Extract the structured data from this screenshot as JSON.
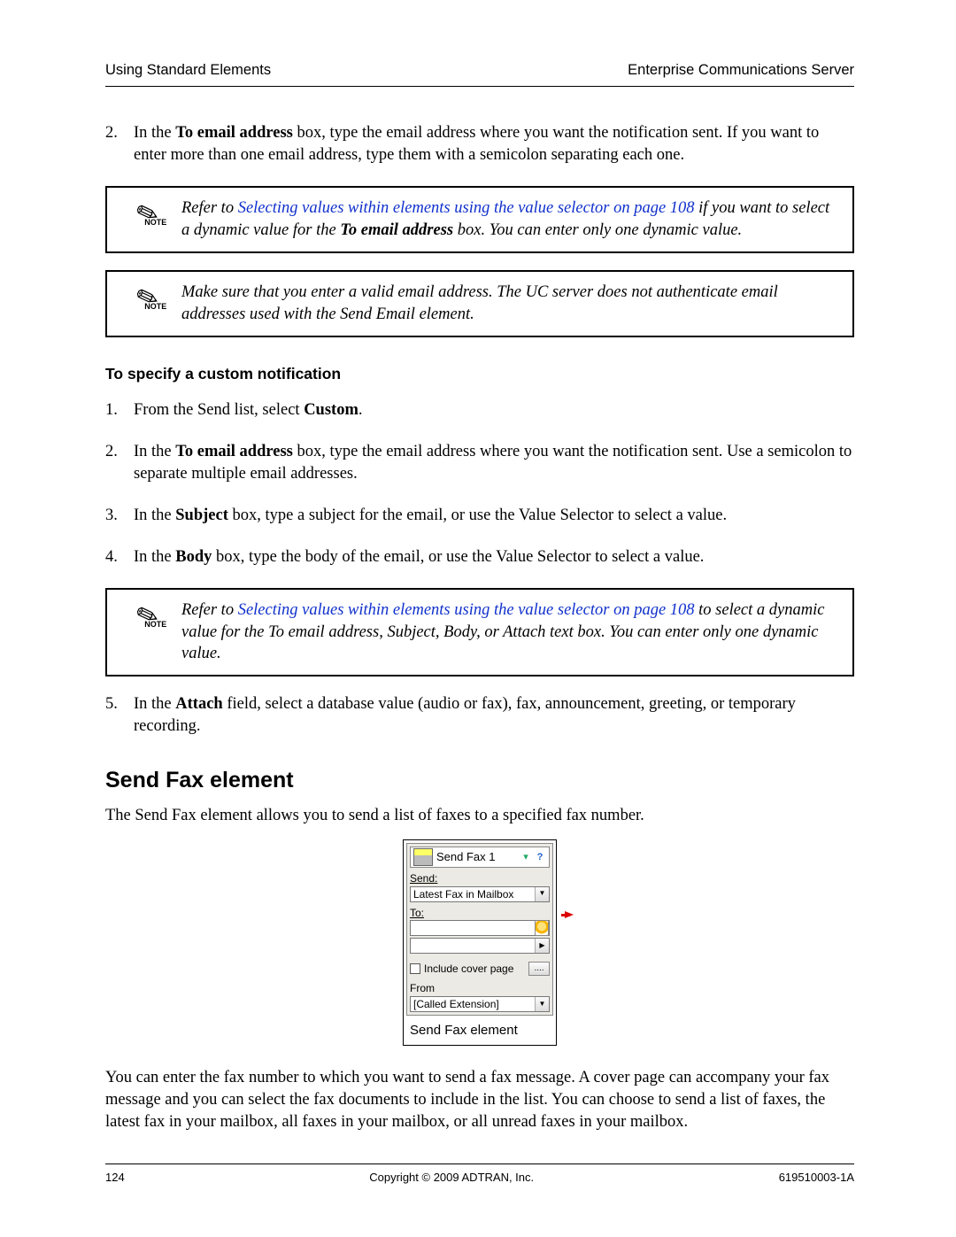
{
  "header": {
    "left": "Using Standard Elements",
    "right": "Enterprise Communications Server"
  },
  "step2": {
    "num": "2.",
    "t1": "In the ",
    "b1": "To email address",
    "t2": " box, type the email address where you want the notification sent. If you want to enter more than one email address, type them with a semicolon separating each one."
  },
  "note1": {
    "pre": "Refer to ",
    "link": "Selecting values within elements using the value selector on page 108",
    "mid": " if you want to select a dynamic value for the ",
    "b": "To email address",
    "post": " box. You can enter only one dynamic value."
  },
  "note2": "Make sure that you enter a valid email address. The UC server does not authenticate email addresses used with the Send Email element.",
  "subhead": "To specify a custom notification",
  "c1": {
    "num": "1.",
    "t1": "From the Send list, select ",
    "b1": "Custom",
    "t2": "."
  },
  "c2": {
    "num": "2.",
    "t1": "In the ",
    "b1": "To email address",
    "t2": " box, type the email address where you want the notification sent. Use a semicolon to separate multiple email addresses."
  },
  "c3": {
    "num": "3.",
    "t1": "In the ",
    "b1": "Subject",
    "t2": " box, type a subject for the email, or use the Value Selector to select a value."
  },
  "c4": {
    "num": "4.",
    "t1": "In the ",
    "b1": "Body",
    "t2": " box, type the body of the email, or use the Value Selector to select a value."
  },
  "note3": {
    "pre": "Refer to ",
    "link": "Selecting values within elements using the value selector on page 108",
    "post": " to select a dynamic value for the To email address, Subject, Body, or Attach text box. You can enter only one dynamic value."
  },
  "c5": {
    "num": "5.",
    "t1": "In the ",
    "b1": "Attach",
    "t2": " field, select a database value (audio or fax), fax, announcement, greeting, or temporary recording."
  },
  "section": "Send Fax element",
  "intro": "The Send Fax element allows you to send a list of faxes to a specified fax number.",
  "fig": {
    "title": "Send Fax 1",
    "send_label": "Send:",
    "send_value": "Latest Fax in Mailbox",
    "to_label": "To:",
    "to_value": "",
    "cover": "Include cover page",
    "dots": "....",
    "from_label": "From",
    "from_value": "[Called Extension]",
    "caption": "Send Fax element"
  },
  "outro": "You can enter the fax number to which you want to send a fax message. A cover page can accompany your fax message and you can select the fax documents to include in the list. You can choose to send a list of faxes, the latest fax in your mailbox, all faxes in your mailbox, or all unread faxes in your mailbox.",
  "footer": {
    "page": "124",
    "center": "Copyright © 2009 ADTRAN, Inc.",
    "right": "619510003-1A"
  },
  "noteWord": "NOTE"
}
